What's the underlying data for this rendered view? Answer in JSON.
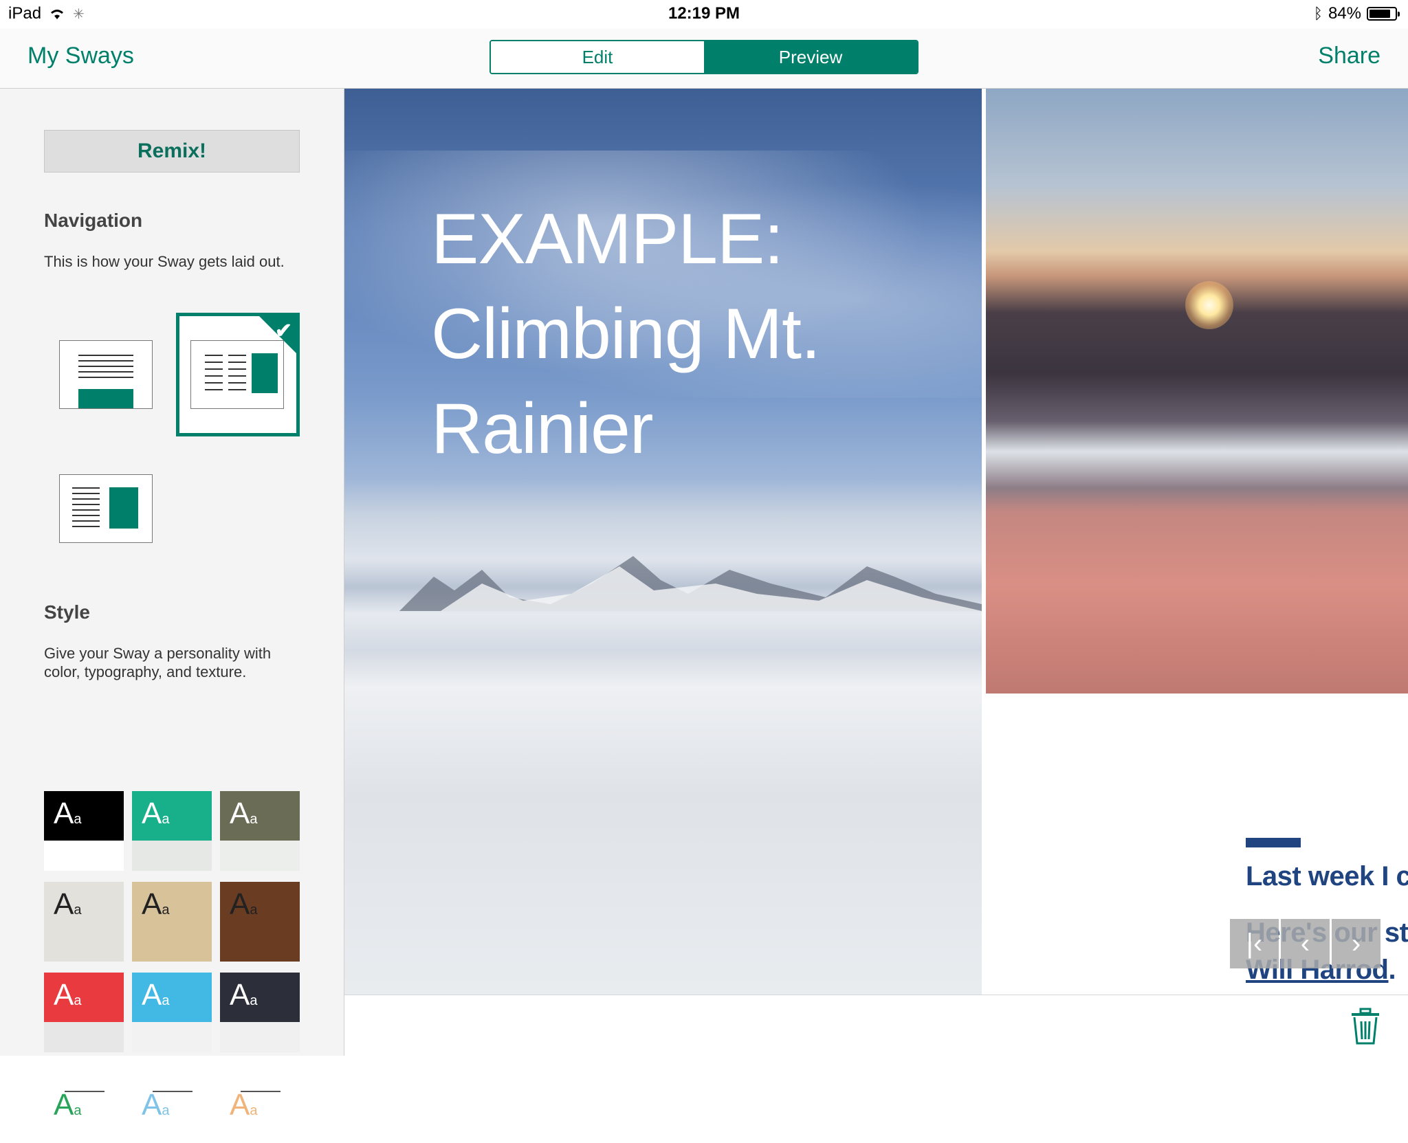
{
  "status": {
    "device": "iPad",
    "time": "12:19 PM",
    "battery_text": "84%",
    "battery_level": 0.84
  },
  "nav": {
    "back_label": "My Sways",
    "share_label": "Share",
    "tabs": [
      {
        "label": "Edit",
        "active": false
      },
      {
        "label": "Preview",
        "active": true
      }
    ]
  },
  "sidebar": {
    "remix_label": "Remix!",
    "navigation": {
      "heading": "Navigation",
      "description": "This is how your Sway gets laid out."
    },
    "style": {
      "heading": "Style",
      "description": "Give your Sway a personality with color, typography, and texture."
    },
    "style_swatches": [
      {
        "big": "A",
        "small": "a",
        "top": "#000000",
        "bottom": "#ffffff",
        "fg": "#ffffff"
      },
      {
        "big": "A",
        "small": "a",
        "top": "#17b08a",
        "bottom": "#e6e8e6",
        "fg": "#ffffff"
      },
      {
        "big": "A",
        "small": "a",
        "top": "#6b6c55",
        "bottom": "#eceeec",
        "fg": "#ffffff"
      },
      {
        "big": "A",
        "small": "a",
        "top": "#e2e1dc",
        "bottom": "#e2e1dc",
        "fg": "#222222"
      },
      {
        "big": "A",
        "small": "a",
        "top": "#d7c29a",
        "bottom": "#d7c29a",
        "fg": "#222222"
      },
      {
        "big": "A",
        "small": "a",
        "top": "#6a3c22",
        "bottom": "#6a3c22",
        "fg": "#222222"
      },
      {
        "big": "A",
        "small": "a",
        "top": "#e83a3f",
        "bottom": "#e7e7e7",
        "fg": "#ffffff"
      },
      {
        "big": "A",
        "small": "a",
        "top": "#42b8e4",
        "bottom": "#f2f2f2",
        "fg": "#ffffff"
      },
      {
        "big": "A",
        "small": "a",
        "top": "#2c2f3a",
        "bottom": "#f0f0f0",
        "fg": "#ffffff"
      },
      {
        "big": "A",
        "small": "a",
        "top": "#ffffff",
        "bottom": "#ffffff",
        "fg": "#2aa45a"
      },
      {
        "big": "A",
        "small": "a",
        "top": "#ffffff",
        "bottom": "#ffffff",
        "fg": "#7fc4e6"
      },
      {
        "big": "A",
        "small": "a",
        "top": "#ffffff",
        "bottom": "#ffffff",
        "fg": "#f0b37a"
      }
    ]
  },
  "preview": {
    "title_line1": "EXAMPLE:",
    "title_line2": "Climbing Mt.",
    "title_line3": "Rainier",
    "story_line1": "Last week I c",
    "story_line2": "Here's our sto",
    "story_link": "Will Harrod",
    "story_period": "."
  },
  "controls": {
    "first_icon": "first-page-icon",
    "prev_icon": "chevron-left-icon",
    "next_icon": "chevron-right-icon",
    "trash_icon": "trash-icon"
  },
  "colors": {
    "accent": "#00806a",
    "story": "#1f4480"
  }
}
